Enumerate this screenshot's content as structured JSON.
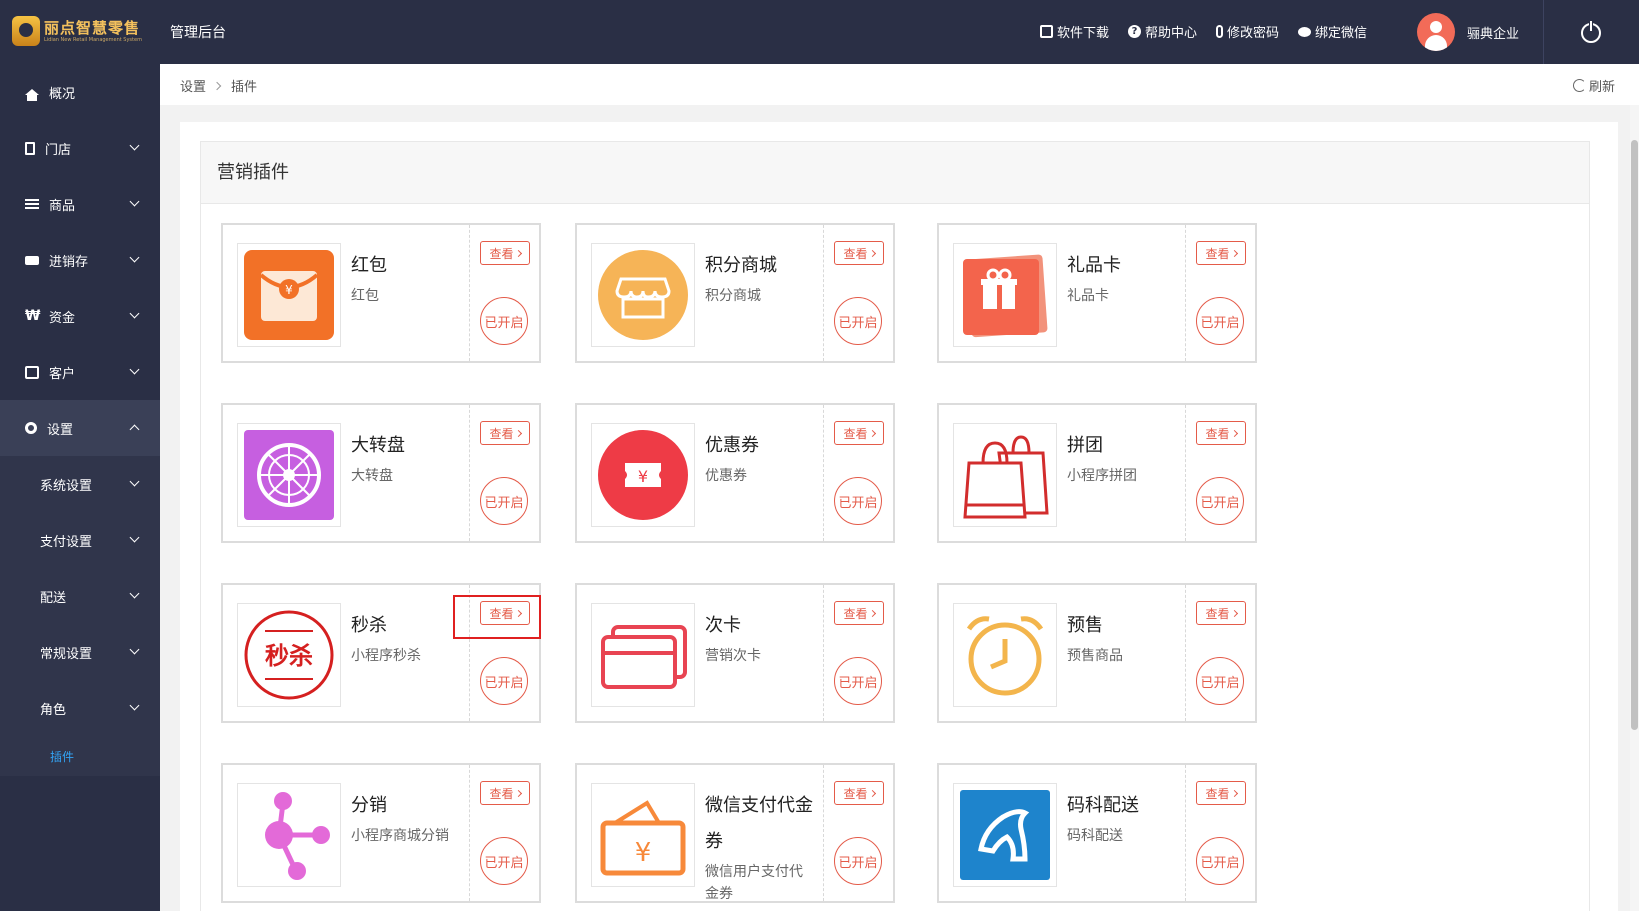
{
  "app": {
    "logo_name": "丽点智慧零售",
    "logo_sub": "Lidian New Retail Management System",
    "admin_title": "管理后台"
  },
  "top_links": [
    {
      "label": "软件下载",
      "icon": "download-icon"
    },
    {
      "label": "帮助中心",
      "icon": "help-icon"
    },
    {
      "label": "修改密码",
      "icon": "key-icon"
    },
    {
      "label": "绑定微信",
      "icon": "wechat-icon"
    }
  ],
  "user": {
    "name": "骊典企业"
  },
  "sidebar": {
    "items": [
      {
        "label": "概况",
        "icon": "home-icon"
      },
      {
        "label": "门店",
        "icon": "store-icon"
      },
      {
        "label": "商品",
        "icon": "list-icon"
      },
      {
        "label": "进销存",
        "icon": "truck-icon"
      },
      {
        "label": "资金",
        "icon": "money-icon"
      },
      {
        "label": "客户",
        "icon": "contact-card-icon"
      },
      {
        "label": "设置",
        "icon": "gear-icon"
      }
    ],
    "settings_sub": [
      {
        "label": "系统设置"
      },
      {
        "label": "支付设置"
      },
      {
        "label": "配送"
      },
      {
        "label": "常规设置"
      },
      {
        "label": "角色"
      }
    ],
    "active_leaf": "插件"
  },
  "breadcrumb": {
    "root": "设置",
    "current": "插件"
  },
  "refresh_label": "刷新",
  "panel": {
    "title": "营销插件"
  },
  "common": {
    "view_label": "查看",
    "enabled_label": "已开启"
  },
  "plugins": [
    {
      "name": "红包",
      "desc": "红包",
      "icon": "red-envelope-icon"
    },
    {
      "name": "积分商城",
      "desc": "积分商城",
      "icon": "points-store-icon"
    },
    {
      "name": "礼品卡",
      "desc": "礼品卡",
      "icon": "gift-card-icon"
    },
    {
      "name": "大转盘",
      "desc": "大转盘",
      "icon": "lucky-wheel-icon"
    },
    {
      "name": "优惠券",
      "desc": "优惠券",
      "icon": "coupon-icon"
    },
    {
      "name": "拼团",
      "desc": "小程序拼团",
      "icon": "shopping-bags-icon"
    },
    {
      "name": "秒杀",
      "desc": "小程序秒杀",
      "icon": "flash-sale-icon"
    },
    {
      "name": "次卡",
      "desc": "营销次卡",
      "icon": "cards-icon"
    },
    {
      "name": "预售",
      "desc": "预售商品",
      "icon": "alarm-clock-icon"
    },
    {
      "name": "分销",
      "desc": "小程序商城分销",
      "icon": "share-network-icon"
    },
    {
      "name": "微信支付代金券",
      "desc": "微信用户支付代金券",
      "icon": "wallet-coupon-icon"
    },
    {
      "name": "码科配送",
      "desc": "码科配送",
      "icon": "maker-delivery-icon"
    }
  ],
  "colors": {
    "sidebar_bg": "#2a2f45",
    "accent_red": "#e45b49",
    "active_link": "#33a3f4"
  }
}
